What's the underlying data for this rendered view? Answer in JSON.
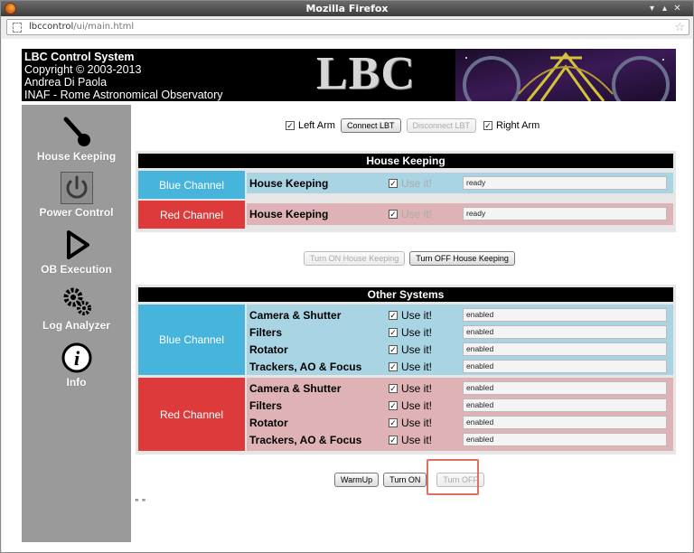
{
  "window": {
    "title": "Mozilla Firefox"
  },
  "url": {
    "host": "lbccontrol",
    "path": "/ui/main.html"
  },
  "banner": {
    "line1": "LBC Control System",
    "line2": "Copyright © 2003-2013",
    "line3": "Andrea Di Paola",
    "line4": "INAF - Rome Astronomical Observatory",
    "logo": "LBC"
  },
  "sidebar": {
    "items": [
      {
        "label": "House Keeping",
        "icon": "thermometer-icon"
      },
      {
        "label": "Power Control",
        "icon": "power-icon"
      },
      {
        "label": "OB Execution",
        "icon": "play-icon"
      },
      {
        "label": "Log Analyzer",
        "icon": "gears-icon"
      },
      {
        "label": "Info",
        "icon": "info-icon"
      }
    ]
  },
  "arms": {
    "left_label": "Left Arm",
    "right_label": "Right Arm",
    "connect": "Connect LBT",
    "disconnect": "Disconnect LBT"
  },
  "housekeeping": {
    "title": "House Keeping",
    "blue_channel": "Blue Channel",
    "red_channel": "Red Channel",
    "rows": [
      {
        "label": "House Keeping",
        "use": "Use it!",
        "value": "ready"
      },
      {
        "label": "House Keeping",
        "use": "Use it!",
        "value": "ready"
      }
    ],
    "turn_on": "Turn ON House Keeping",
    "turn_off": "Turn OFF House Keeping"
  },
  "other": {
    "title": "Other Systems",
    "blue_channel": "Blue Channel",
    "red_channel": "Red Channel",
    "blue_rows": [
      {
        "label": "Camera & Shutter",
        "use": "Use it!",
        "value": "enabled"
      },
      {
        "label": "Filters",
        "use": "Use it!",
        "value": "enabled"
      },
      {
        "label": "Rotator",
        "use": "Use it!",
        "value": "enabled"
      },
      {
        "label": "Trackers, AO & Focus",
        "use": "Use it!",
        "value": "enabled"
      }
    ],
    "red_rows": [
      {
        "label": "Camera & Shutter",
        "use": "Use it!",
        "value": "enabled"
      },
      {
        "label": "Filters",
        "use": "Use it!",
        "value": "enabled"
      },
      {
        "label": "Rotator",
        "use": "Use it!",
        "value": "enabled"
      },
      {
        "label": "Trackers, AO & Focus",
        "use": "Use it!",
        "value": "enabled"
      }
    ]
  },
  "actions": {
    "warmup": "WarmUp",
    "turn_on": "Turn ON",
    "turn_off": "Turn OFF"
  },
  "footer_mark": "\" \""
}
